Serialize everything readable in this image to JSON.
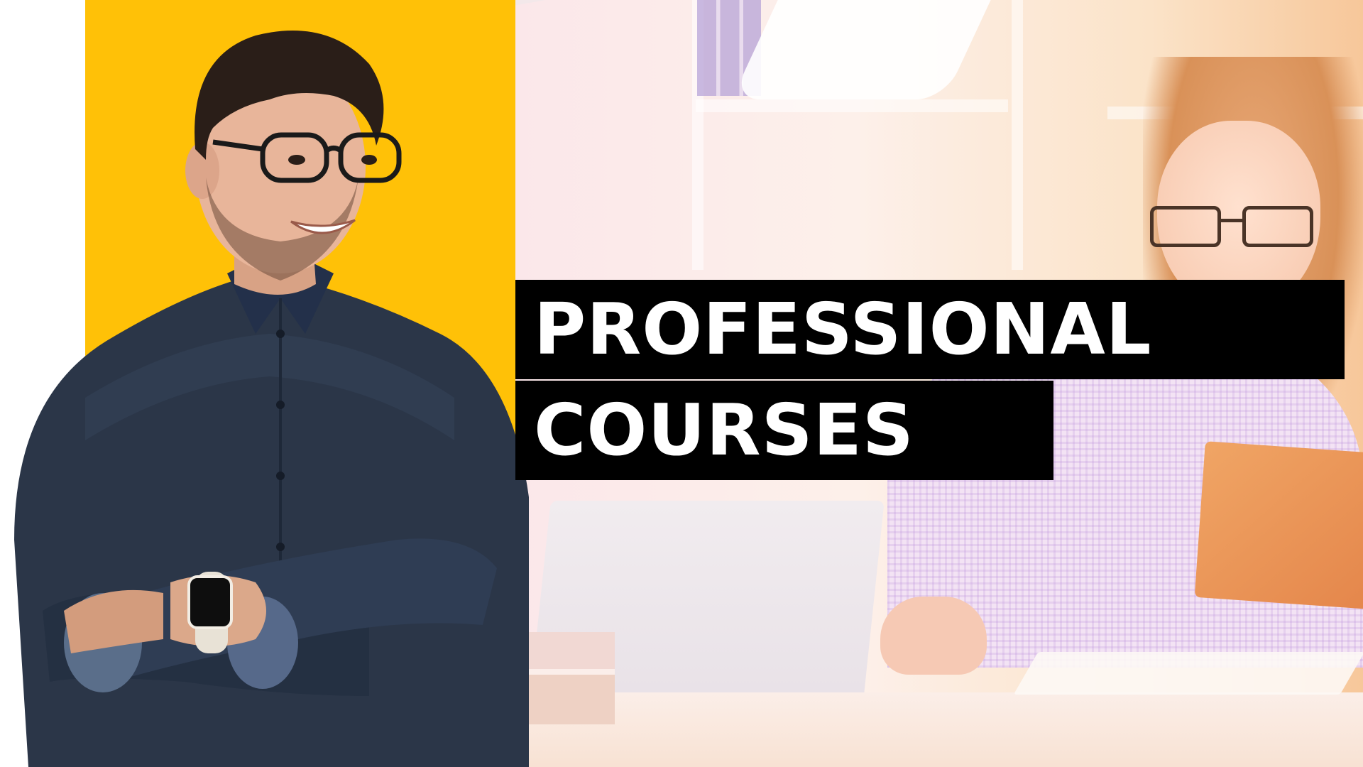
{
  "headline": {
    "line1": "PROFESSIONAL",
    "line2": "COURSES"
  },
  "colors": {
    "accent_yellow": "#ffc107",
    "headline_bg": "#000000",
    "headline_text": "#ffffff",
    "shirt_denim": "#2b3648"
  }
}
